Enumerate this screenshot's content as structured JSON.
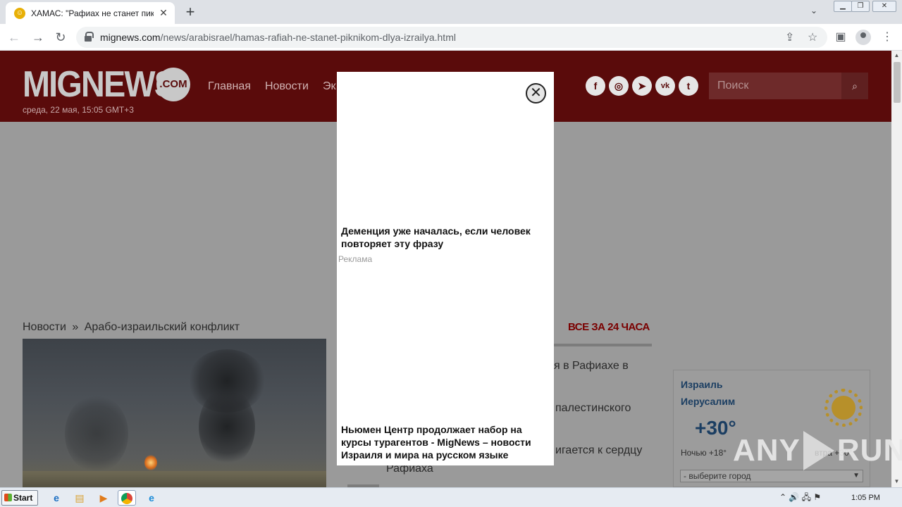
{
  "browser": {
    "tab_title": "ХАМАС: \"Рафиах не станет пикни",
    "tab_close": "✕",
    "new_tab": "+",
    "url_domain": "mignews.com",
    "url_path": "/news/arabisrael/hamas-rafiah-ne-stanet-piknikom-dlya-izrailya.html",
    "back": "←",
    "forward": "→",
    "reload": "↻",
    "share": "⇪",
    "star": "☆",
    "sidebar": "▣",
    "menu": "⋮",
    "tab_dropdown": "⌄",
    "win_minimize": "▁",
    "win_restore": "❐",
    "win_close": "✕"
  },
  "site": {
    "logo": "MIGNEWS",
    "logo_suffix": ".COM",
    "datetime": "среда, 22 мая, 15:05 GMT+3",
    "nav": [
      {
        "label": "Главная"
      },
      {
        "label": "Новости"
      },
      {
        "label": "Эк"
      }
    ],
    "social": [
      {
        "icon": "facebook-icon",
        "glyph": "f"
      },
      {
        "icon": "instagram-icon",
        "glyph": "◎"
      },
      {
        "icon": "telegram-icon",
        "glyph": "➤"
      },
      {
        "icon": "vk-icon",
        "glyph": "vk"
      },
      {
        "icon": "twitter-icon",
        "glyph": "t"
      }
    ],
    "search_placeholder": "Поиск",
    "search_icon": "⌕"
  },
  "breadcrumb": {
    "home": "Новости",
    "separator": "»",
    "section": "Арабо-израильский конфликт"
  },
  "sidebar": {
    "title": "ВСЕ ЗА 24 ЧАСА",
    "items": [
      {
        "line1": "я в Рафиахе в"
      },
      {
        "line1": "палестинского"
      },
      {
        "line1": "игается к сердцу",
        "line2": "Рафиаха"
      }
    ]
  },
  "weather": {
    "country": "Израиль",
    "city": "Иерусалим",
    "temp": "+30°",
    "night": "Ночью +18°",
    "tomorrow": "втра +30°",
    "select": "- выберите город"
  },
  "modal": {
    "close": "✕",
    "headline1": "Деменция уже началась, если человек повторяет эту фразу",
    "ad_label": "Реклама",
    "headline2": "Ньюмен Центр продолжает набор на курсы турагентов - MigNews – новости Израиля и мира на русском языке"
  },
  "watermark": {
    "left": "ANY",
    "right": "RUN"
  },
  "taskbar": {
    "start": "Start",
    "clock": "1:05 PM",
    "tray": "⌃  🔊  🖧  ⚑"
  },
  "colors": {
    "header_bg": "#5a0b0b",
    "overlay_gray": "#9a9a9a",
    "accent_red": "#7a0000"
  }
}
